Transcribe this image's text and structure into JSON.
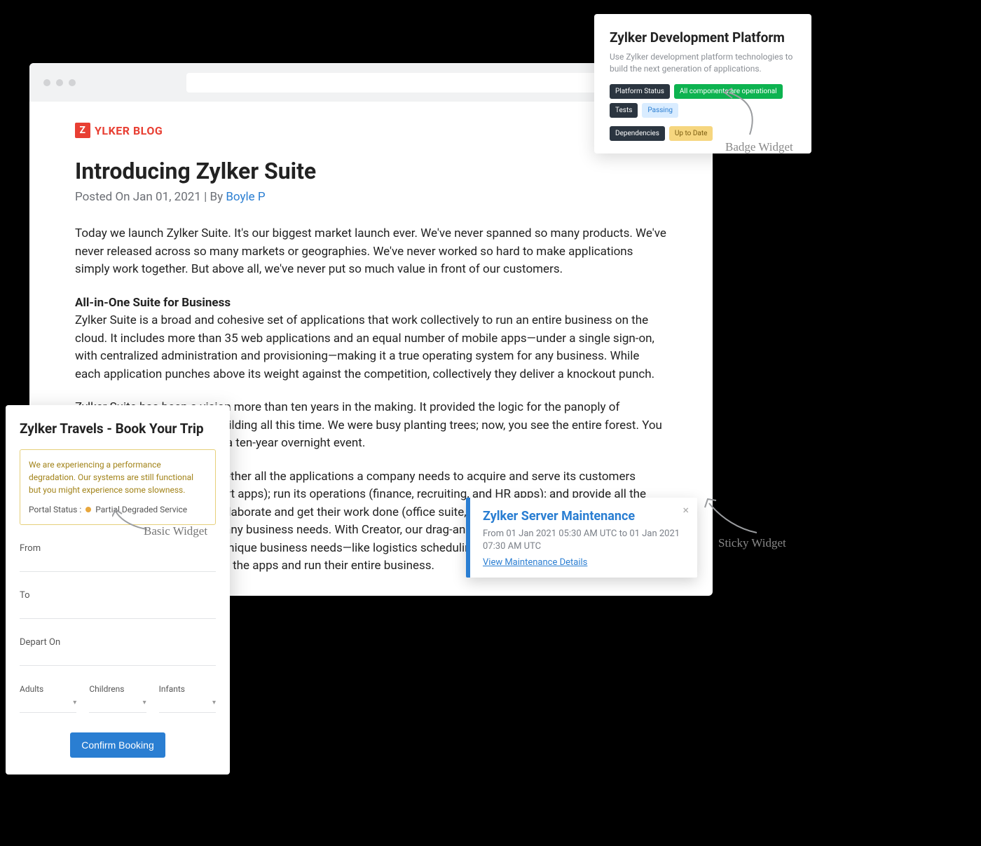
{
  "blog": {
    "logo_letter": "Z",
    "logo_text": "YLKER BLOG",
    "title": "Introducing Zylker Suite",
    "posted_prefix": "Posted On ",
    "posted_date": "Jan 01, 2021",
    "by_prefix": " | By ",
    "author": "Boyle P",
    "p1": "Today we launch Zylker Suite. It's our biggest market launch ever. We've never spanned so many products. We've never released across so many markets or geographies. We've never worked so hard to make applications simply work together. But above all, we've never put so much value in front of our customers.",
    "section_head": "All-in-One Suite for Business",
    "p2": "Zylker Suite is a broad and cohesive set of applications that work collectively to run an entire business on the cloud. It includes more than 35 web applications and an equal number of mobile apps—under a single sign-on, with centralized administration and provisioning—making it a true operating system for any business. While each application punches above its weight against the competition, collectively they deliver a knockout punch.",
    "p3": "Zylker Suite has been a vision more than ten years in the making. It provided the logic for the panoply of business apps we've been building all this time. We were busy planting trees; now, you see the entire forest. You could even say that it's been a ten-year overnight event.",
    "p4": "With Zylker Suite, we put together all the applications a company needs to acquire and serve its customers (marketing, sales, and support apps); run its operations (finance, recruiting, and HR apps); and provide all the tools for its employees to collaborate and get their work done (office suite, mail, personal productivity, and collaboration apps). Almost any business needs. With Creator, our drag-and-drop app builder, customers can even build custom apps for unique business needs—like logistics scheduling—and put them under the same umbrella that ties together all the apps and run their entire business."
  },
  "badge_card": {
    "title": "Zylker Development Platform",
    "sub": "Use Zylker development platform technologies to build the next generation of applications.",
    "badges": {
      "platform_label": "Platform Status",
      "platform_value": "All components are operational",
      "tests_label": "Tests",
      "tests_value": "Passing",
      "deps_label": "Dependencies",
      "deps_value": "Up to Date"
    }
  },
  "labels": {
    "badge_widget": "Badge Widget",
    "sticky_widget": "Sticky Widget",
    "basic_widget": "Basic Widget"
  },
  "sticky": {
    "title": "Zylker Server Maintenance",
    "sub": "From 01 Jan 2021 05:30 AM UTC to 01 Jan 2021 07:30 AM UTC",
    "link": "View Maintenance Details",
    "close": "×"
  },
  "travel": {
    "title": "Zylker Travels - Book Your Trip",
    "warn": "We are experiencing a performance degradation. Our systems are still functional but you might experience some slowness.",
    "status_label": "Portal Status : ",
    "status_text": "Partial Degraded Service",
    "from": "From",
    "to": "To",
    "depart": "Depart On",
    "adults": "Adults",
    "children": "Childrens",
    "infants": "Infants",
    "confirm": "Confirm Booking"
  }
}
